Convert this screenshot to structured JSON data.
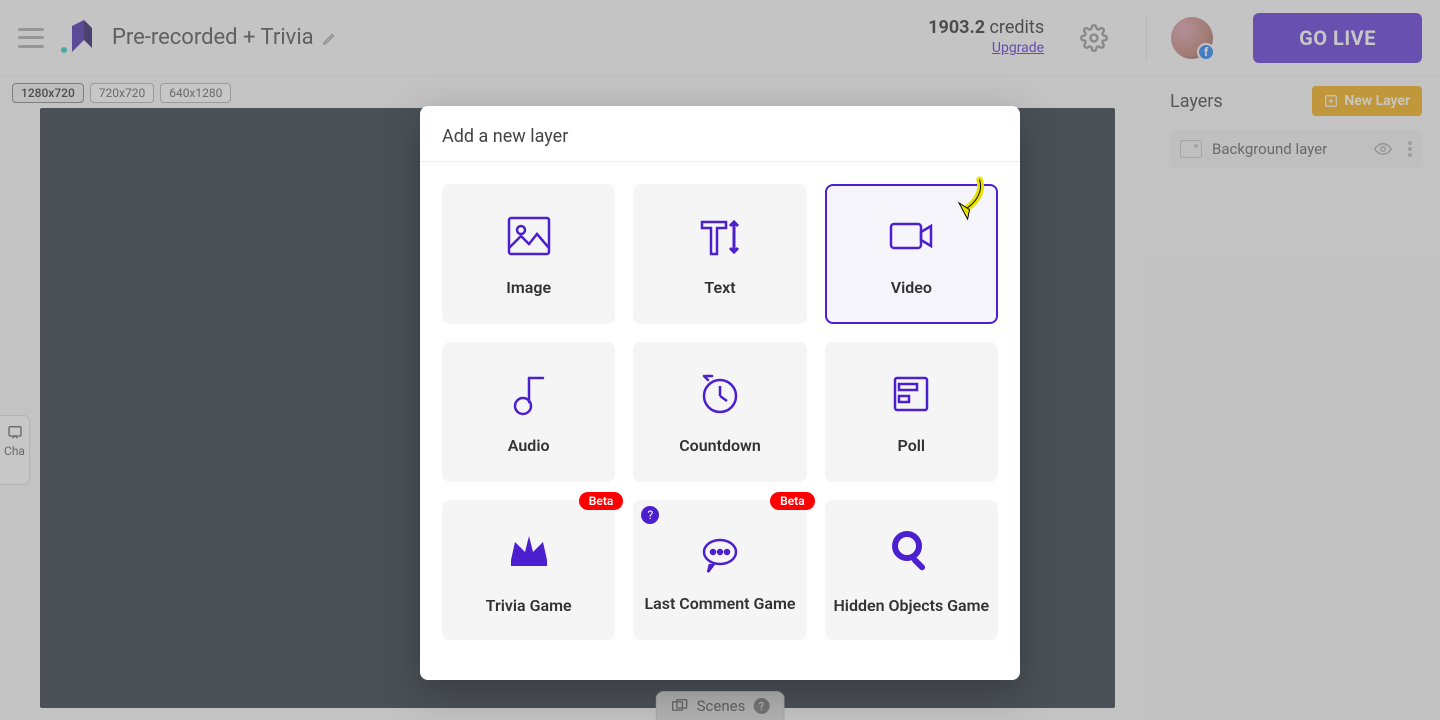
{
  "header": {
    "title": "Pre-recorded + Trivia",
    "credits_amount": "1903.2",
    "credits_label": "credits",
    "upgrade": "Upgrade",
    "go_live": "GO LIVE",
    "avatar_badge": "f"
  },
  "sizes": [
    "1280x720",
    "720x720",
    "640x1280"
  ],
  "active_size_index": 0,
  "chat_tab": "Cha",
  "scenes_label": "Scenes",
  "right_panel": {
    "title": "Layers",
    "new_layer": "New Layer",
    "items": [
      "Background layer"
    ]
  },
  "modal": {
    "title": "Add a new layer",
    "beta_label": "Beta",
    "tiles": [
      {
        "id": "image",
        "label": "Image"
      },
      {
        "id": "text",
        "label": "Text"
      },
      {
        "id": "video",
        "label": "Video",
        "selected": true
      },
      {
        "id": "audio",
        "label": "Audio"
      },
      {
        "id": "countdown",
        "label": "Countdown"
      },
      {
        "id": "poll",
        "label": "Poll"
      },
      {
        "id": "trivia",
        "label": "Trivia Game",
        "beta": true
      },
      {
        "id": "lastcomment",
        "label": "Last Comment Game",
        "beta": true,
        "help": true
      },
      {
        "id": "hidden",
        "label": "Hidden Objects Game"
      }
    ]
  }
}
